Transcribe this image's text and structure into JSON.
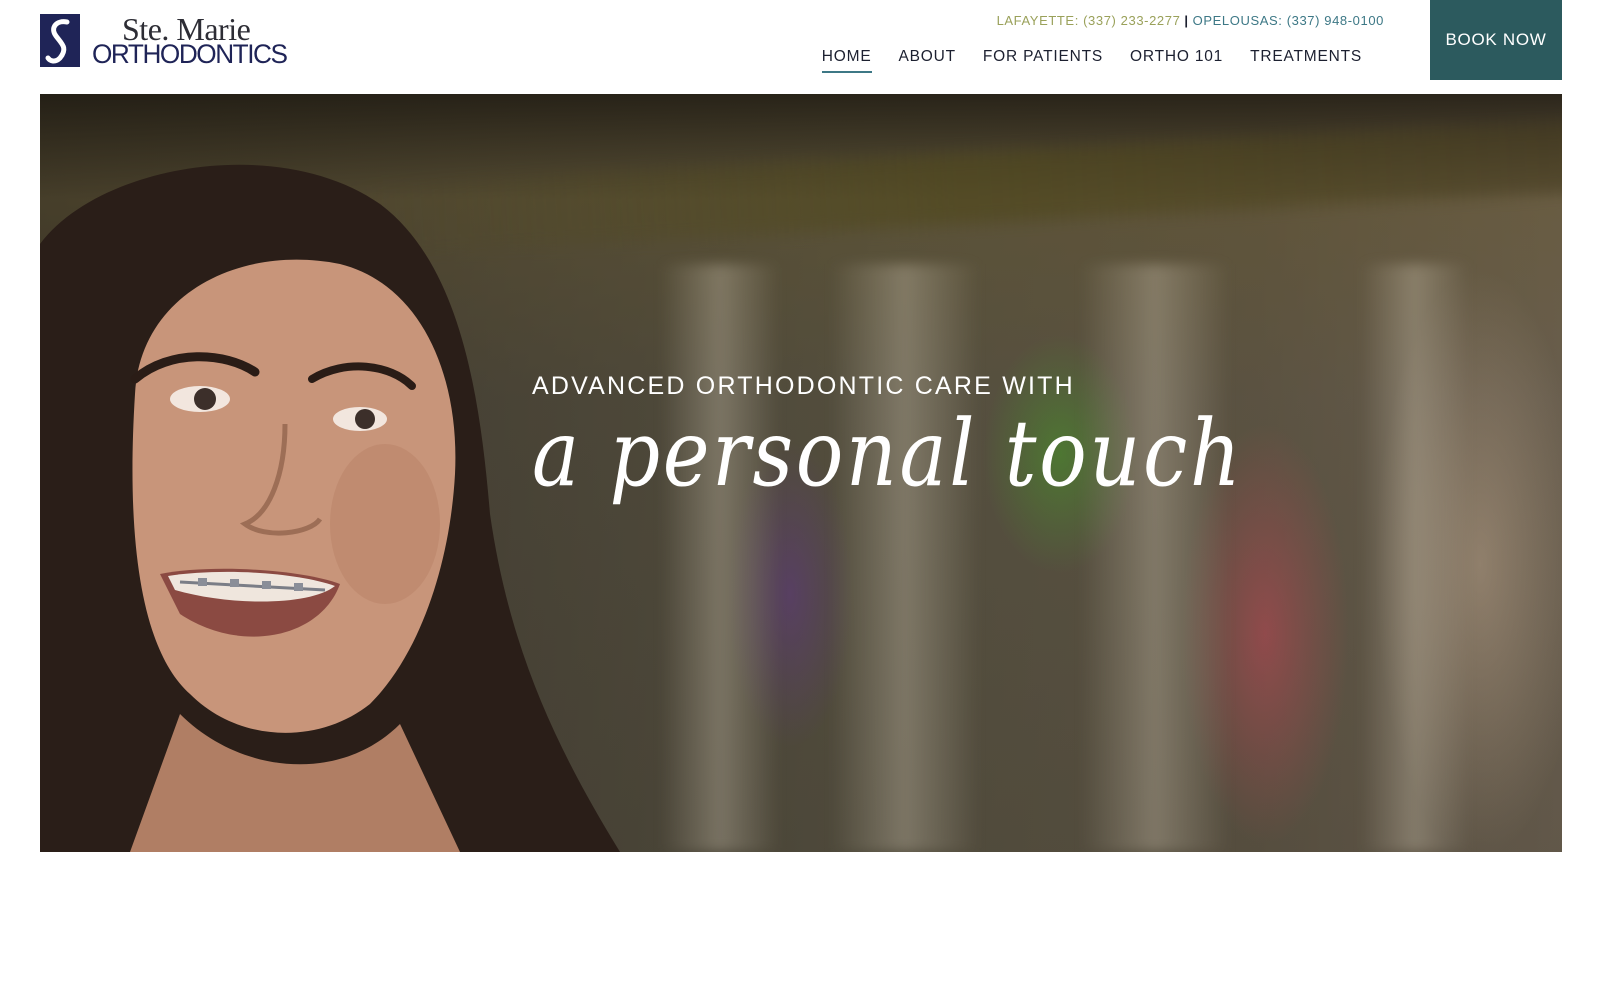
{
  "header": {
    "logo": {
      "line1": "Ste. Marie",
      "line2": "ORTHODONTICS"
    },
    "phones": {
      "lafayette": "LAFAYETTE: (337) 233-2277",
      "separator": "|",
      "opelousas": "OPELOUSAS: (337) 948-0100"
    },
    "nav": [
      {
        "label": "HOME",
        "active": true
      },
      {
        "label": "ABOUT"
      },
      {
        "label": "FOR PATIENTS"
      },
      {
        "label": "ORTHO 101"
      },
      {
        "label": "TREATMENTS"
      }
    ],
    "book_now_label": "BOOK NOW"
  },
  "hero": {
    "kicker": "ADVANCED ORTHODONTIC CARE WITH",
    "script": "a personal touch"
  },
  "colors": {
    "brand_navy": "#1f2457",
    "teal": "#2c5a5e",
    "phone_green": "#9aa15a",
    "phone_teal": "#3d7886"
  }
}
